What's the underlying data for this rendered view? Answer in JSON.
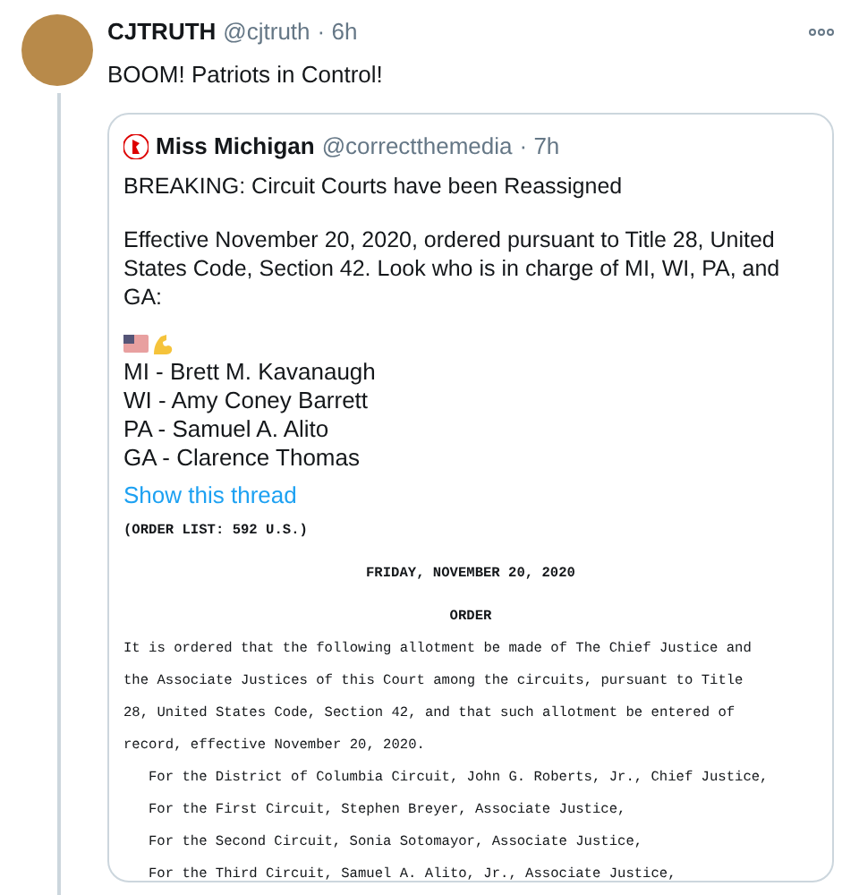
{
  "tweet": {
    "name": "CJTRUTH",
    "handle": "@cjtruth",
    "time": "· 6h",
    "text": "BOOM! Patriots in Control!",
    "quote": {
      "name": "Miss Michigan",
      "handle": "@correctthemedia",
      "time": "· 7h",
      "paragraphs": [
        "BREAKING: Circuit Courts have been Reassigned",
        "Effective November 20, 2020, ordered pursuant to Title 28, United States Code, Section 42. Look who is in charge of MI, WI, PA, and GA:"
      ],
      "assignments": [
        "MI - Brett M. Kavanaugh",
        "WI - Amy Coney Barrett",
        "PA - Samuel A. Alito",
        "GA - Clarence Thomas"
      ],
      "link": "Show this thread",
      "document": {
        "order_list": "(ORDER LIST: 592 U.S.)",
        "date": "FRIDAY, NOVEMBER 20, 2020",
        "heading": "ORDER",
        "body": "It is ordered that the following allotment be made of The Chief Justice and the Associate Justices of this Court among the circuits, pursuant to Title 28, United States Code, Section 42, and that such allotment be entered of record, effective November 20, 2020.",
        "lines": [
          "For the District of Columbia Circuit, John G. Roberts, Jr., Chief Justice,",
          "For the First Circuit, Stephen Breyer, Associate Justice,",
          "For the Second Circuit, Sonia Sotomayor, Associate Justice,",
          "For the Third Circuit, Samuel A. Alito, Jr., Associate Justice,"
        ]
      }
    }
  }
}
